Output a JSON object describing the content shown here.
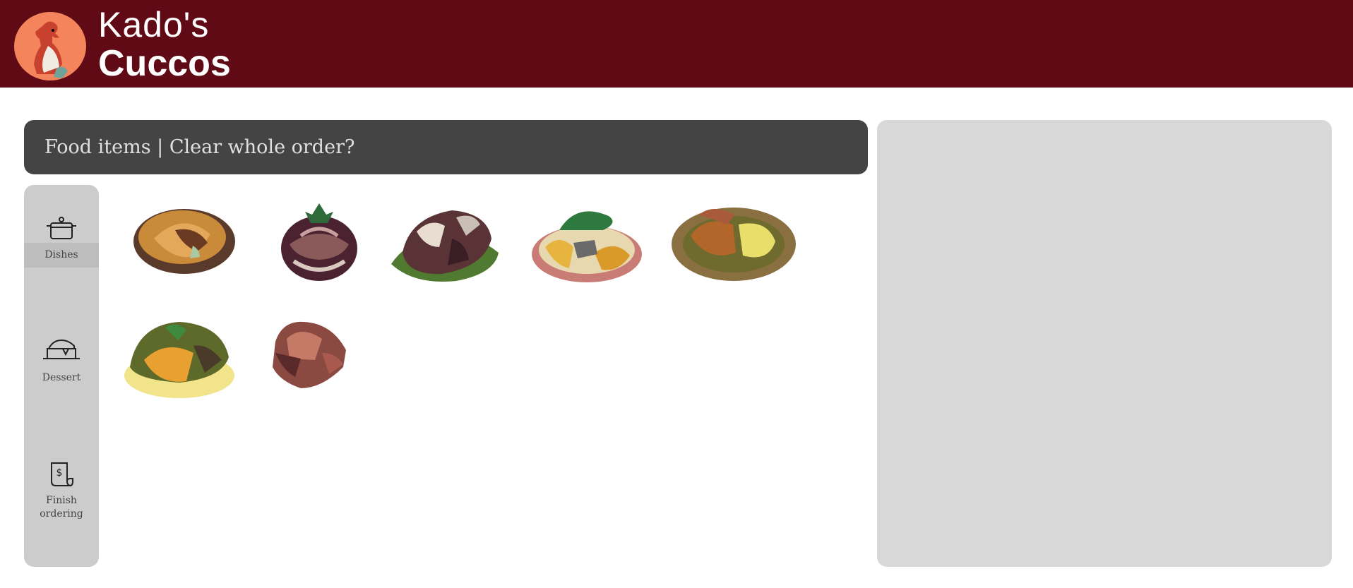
{
  "header": {
    "title_line1": "Kado's",
    "title_line2": "Cuccos",
    "brand_color": "#5f0a15"
  },
  "order_bar": {
    "food_items_label": "Food items",
    "separator": " | ",
    "clear_label": "Clear whole order?"
  },
  "sidebar": {
    "items": [
      {
        "label": "Dishes",
        "icon": "pot-icon",
        "active": true
      },
      {
        "label": "Dessert",
        "icon": "cake-icon",
        "active": false
      },
      {
        "label": "Finish ordering",
        "icon": "receipt-icon",
        "active": false
      }
    ]
  },
  "food_items": [
    {
      "icon": "meat-pie-icon"
    },
    {
      "icon": "steamed-dumpling-icon"
    },
    {
      "icon": "roasted-meat-icon"
    },
    {
      "icon": "seafood-plate-icon"
    },
    {
      "icon": "curry-plate-icon"
    },
    {
      "icon": "omelet-plate-icon"
    },
    {
      "icon": "meat-skewer-icon"
    }
  ]
}
